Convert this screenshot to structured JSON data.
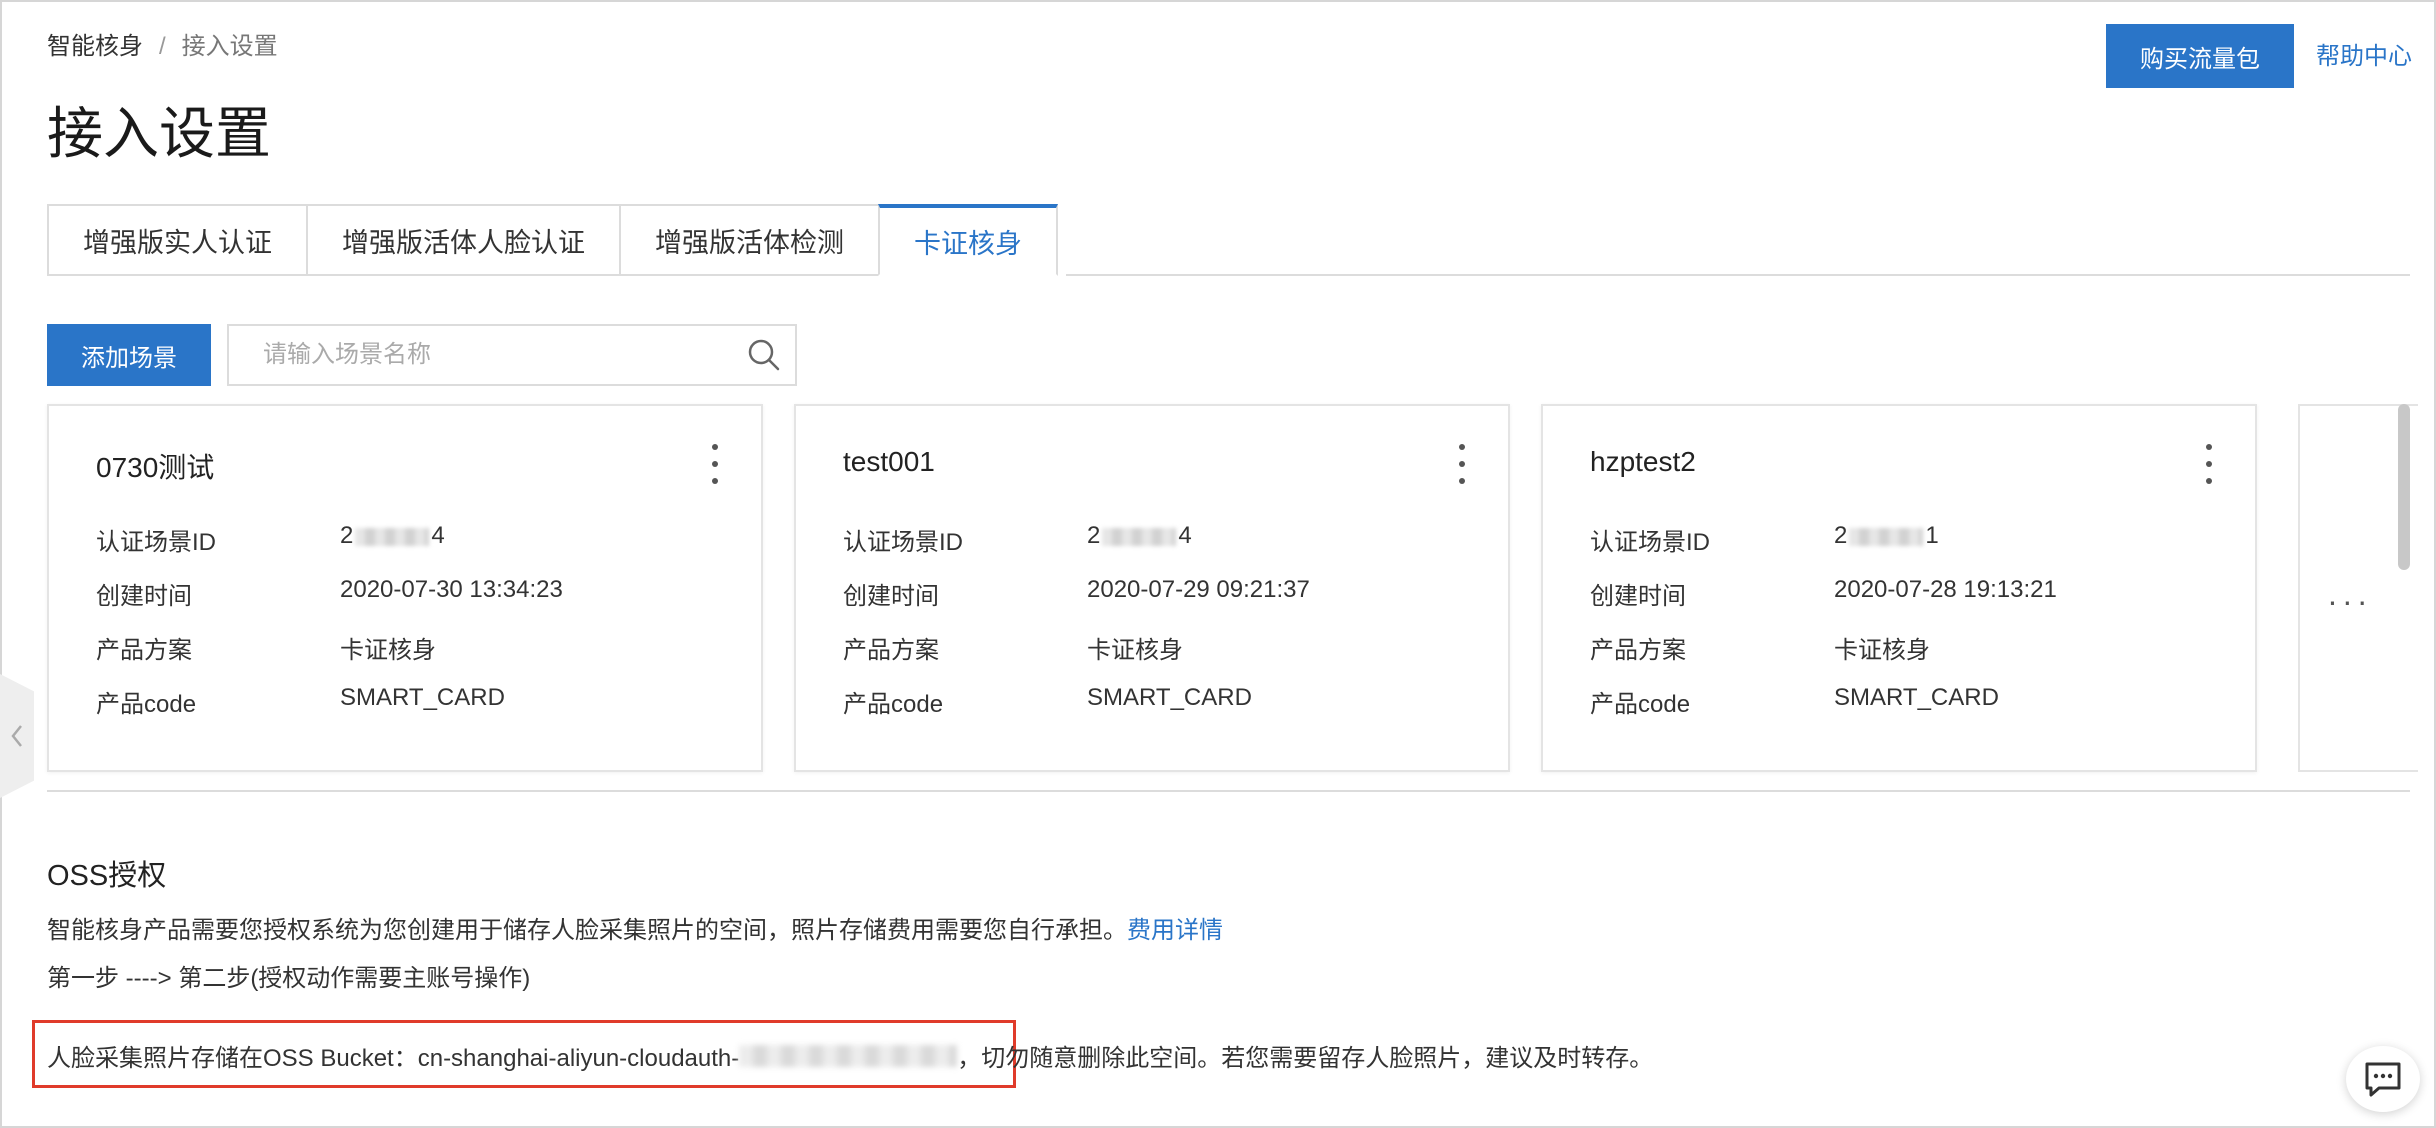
{
  "breadcrumb": {
    "home": "智能核身",
    "separator": "/",
    "current": "接入设置"
  },
  "header": {
    "buy_button": "购买流量包",
    "help_link": "帮助中心"
  },
  "page_title": "接入设置",
  "tabs": [
    {
      "label": "增强版实人认证"
    },
    {
      "label": "增强版活体人脸认证"
    },
    {
      "label": "增强版活体检测"
    },
    {
      "label": "卡证核身",
      "active": true
    }
  ],
  "toolbar": {
    "add_button": "添加场景",
    "search_placeholder": "请输入场景名称",
    "search_icon": "search-icon"
  },
  "cards": [
    {
      "title": "0730测试",
      "scene_id_label": "认证场景ID",
      "scene_id_prefix": "2",
      "scene_id_suffix": "4",
      "created_label": "创建时间",
      "created_value": "2020-07-30 13:34:23",
      "plan_label": "产品方案",
      "plan_value": "卡证核身",
      "code_label": "产品code",
      "code_value": "SMART_CARD"
    },
    {
      "title": "test001",
      "scene_id_label": "认证场景ID",
      "scene_id_prefix": "2",
      "scene_id_suffix": "4",
      "created_label": "创建时间",
      "created_value": "2020-07-29 09:21:37",
      "plan_label": "产品方案",
      "plan_value": "卡证核身",
      "code_label": "产品code",
      "code_value": "SMART_CARD"
    },
    {
      "title": "hzptest2",
      "scene_id_label": "认证场景ID",
      "scene_id_prefix": "2",
      "scene_id_suffix": "1",
      "created_label": "创建时间",
      "created_value": "2020-07-28 19:13:21",
      "plan_label": "产品方案",
      "plan_value": "卡证核身",
      "code_label": "产品code",
      "code_value": "SMART_CARD"
    }
  ],
  "more_cards": "...",
  "oss": {
    "title": "OSS授权",
    "description": "智能核身产品需要您授权系统为您创建用于储存人脸采集照片的空间，照片存储费用需要您自行承担。",
    "fee_link": "费用详情",
    "steps": "第一步 ----> 第二步(授权动作需要主账号操作)",
    "bucket_prefix": "人脸采集照片存储在OSS Bucket：cn-shanghai-aliyun-cloudauth-",
    "bucket_suffix": "，切勿随意删除此空间。若您需要留存人脸照片，建议及时转存。"
  },
  "colors": {
    "primary": "#2a75c8",
    "highlight": "#e03b2a"
  }
}
